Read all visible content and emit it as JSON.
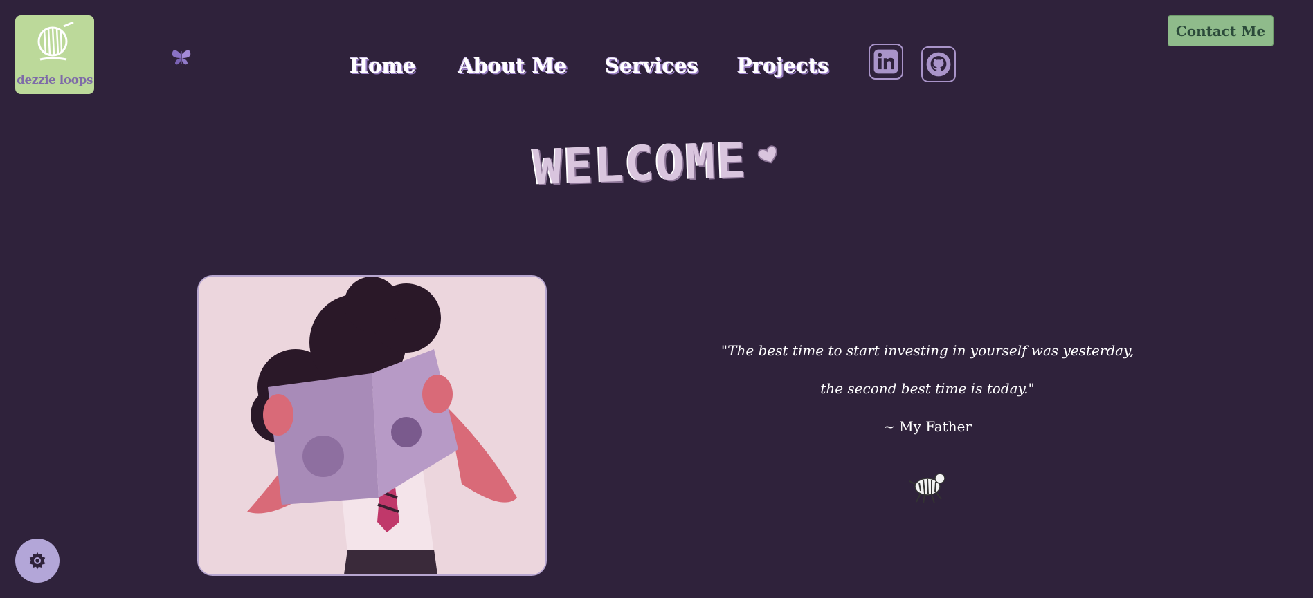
{
  "brand": {
    "logo_text": "dezzie loops"
  },
  "nav": {
    "home": "Home",
    "about": "About Me",
    "services": "Services",
    "projects": "Projects"
  },
  "social": {
    "linkedin_icon": "linkedin-icon",
    "github_icon": "github-icon"
  },
  "header": {
    "contact_label": "Contact Me"
  },
  "hero": {
    "welcome_text": "WELCOME"
  },
  "quote": {
    "line1": "\"The best time to start investing in yourself was yesterday,",
    "line2": "the second best time is today.\"",
    "author": "~ My Father"
  },
  "colors": {
    "background": "#2f223b",
    "logo_bg": "#bcd99a",
    "contact_bg": "#8fbb8b",
    "accent_lavender": "#b3a6d8"
  }
}
